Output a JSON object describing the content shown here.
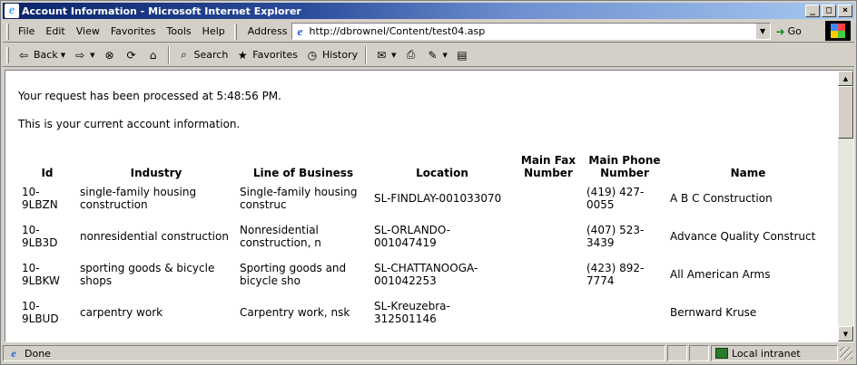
{
  "window": {
    "title": "Account Information - Microsoft Internet Explorer"
  },
  "menu": {
    "items": [
      {
        "label": "File"
      },
      {
        "label": "Edit"
      },
      {
        "label": "View"
      },
      {
        "label": "Favorites"
      },
      {
        "label": "Tools"
      },
      {
        "label": "Help"
      }
    ],
    "address_label": "Address",
    "address_value": "http://dbrownel/Content/test04.asp",
    "go_label": "Go"
  },
  "toolbar": {
    "back_label": "Back",
    "search_label": "Search",
    "favorites_label": "Favorites",
    "history_label": "History"
  },
  "content": {
    "message1": "Your request has been processed at 5:48:56 PM.",
    "message2": "This is your current account information.",
    "table": {
      "headers": {
        "id": "Id",
        "industry": "Industry",
        "line_of_business": "Line of Business",
        "location": "Location",
        "main_fax_number": "Main Fax Number",
        "main_phone_number": "Main Phone Number",
        "name": "Name"
      },
      "rows": [
        {
          "id": "10-9LBZN",
          "industry": "single-family housing construction",
          "line_of_business": "Single-family housing construc",
          "location": "SL-FINDLAY-001033070",
          "fax": "",
          "phone": "(419) 427-0055",
          "name": "A B C Construction"
        },
        {
          "id": "10-9LB3D",
          "industry": "nonresidential construction",
          "line_of_business": "Nonresidential construction, n",
          "location": "SL-ORLANDO-001047419",
          "fax": "",
          "phone": "(407) 523-3439",
          "name": "Advance Quality Construct"
        },
        {
          "id": "10-9LBKW",
          "industry": "sporting goods & bicycle shops",
          "line_of_business": "Sporting goods and bicycle sho",
          "location": "SL-CHATTANOOGA-001042253",
          "fax": "",
          "phone": "(423) 892-7774",
          "name": "All American Arms"
        },
        {
          "id": "10-9LBUD",
          "industry": "carpentry work",
          "line_of_business": "Carpentry work, nsk",
          "location": "SL-Kreuzebra-312501146",
          "fax": "",
          "phone": "",
          "name": "Bernward Kruse"
        }
      ]
    }
  },
  "status": {
    "text": "Done",
    "zone": "Local intranet"
  }
}
